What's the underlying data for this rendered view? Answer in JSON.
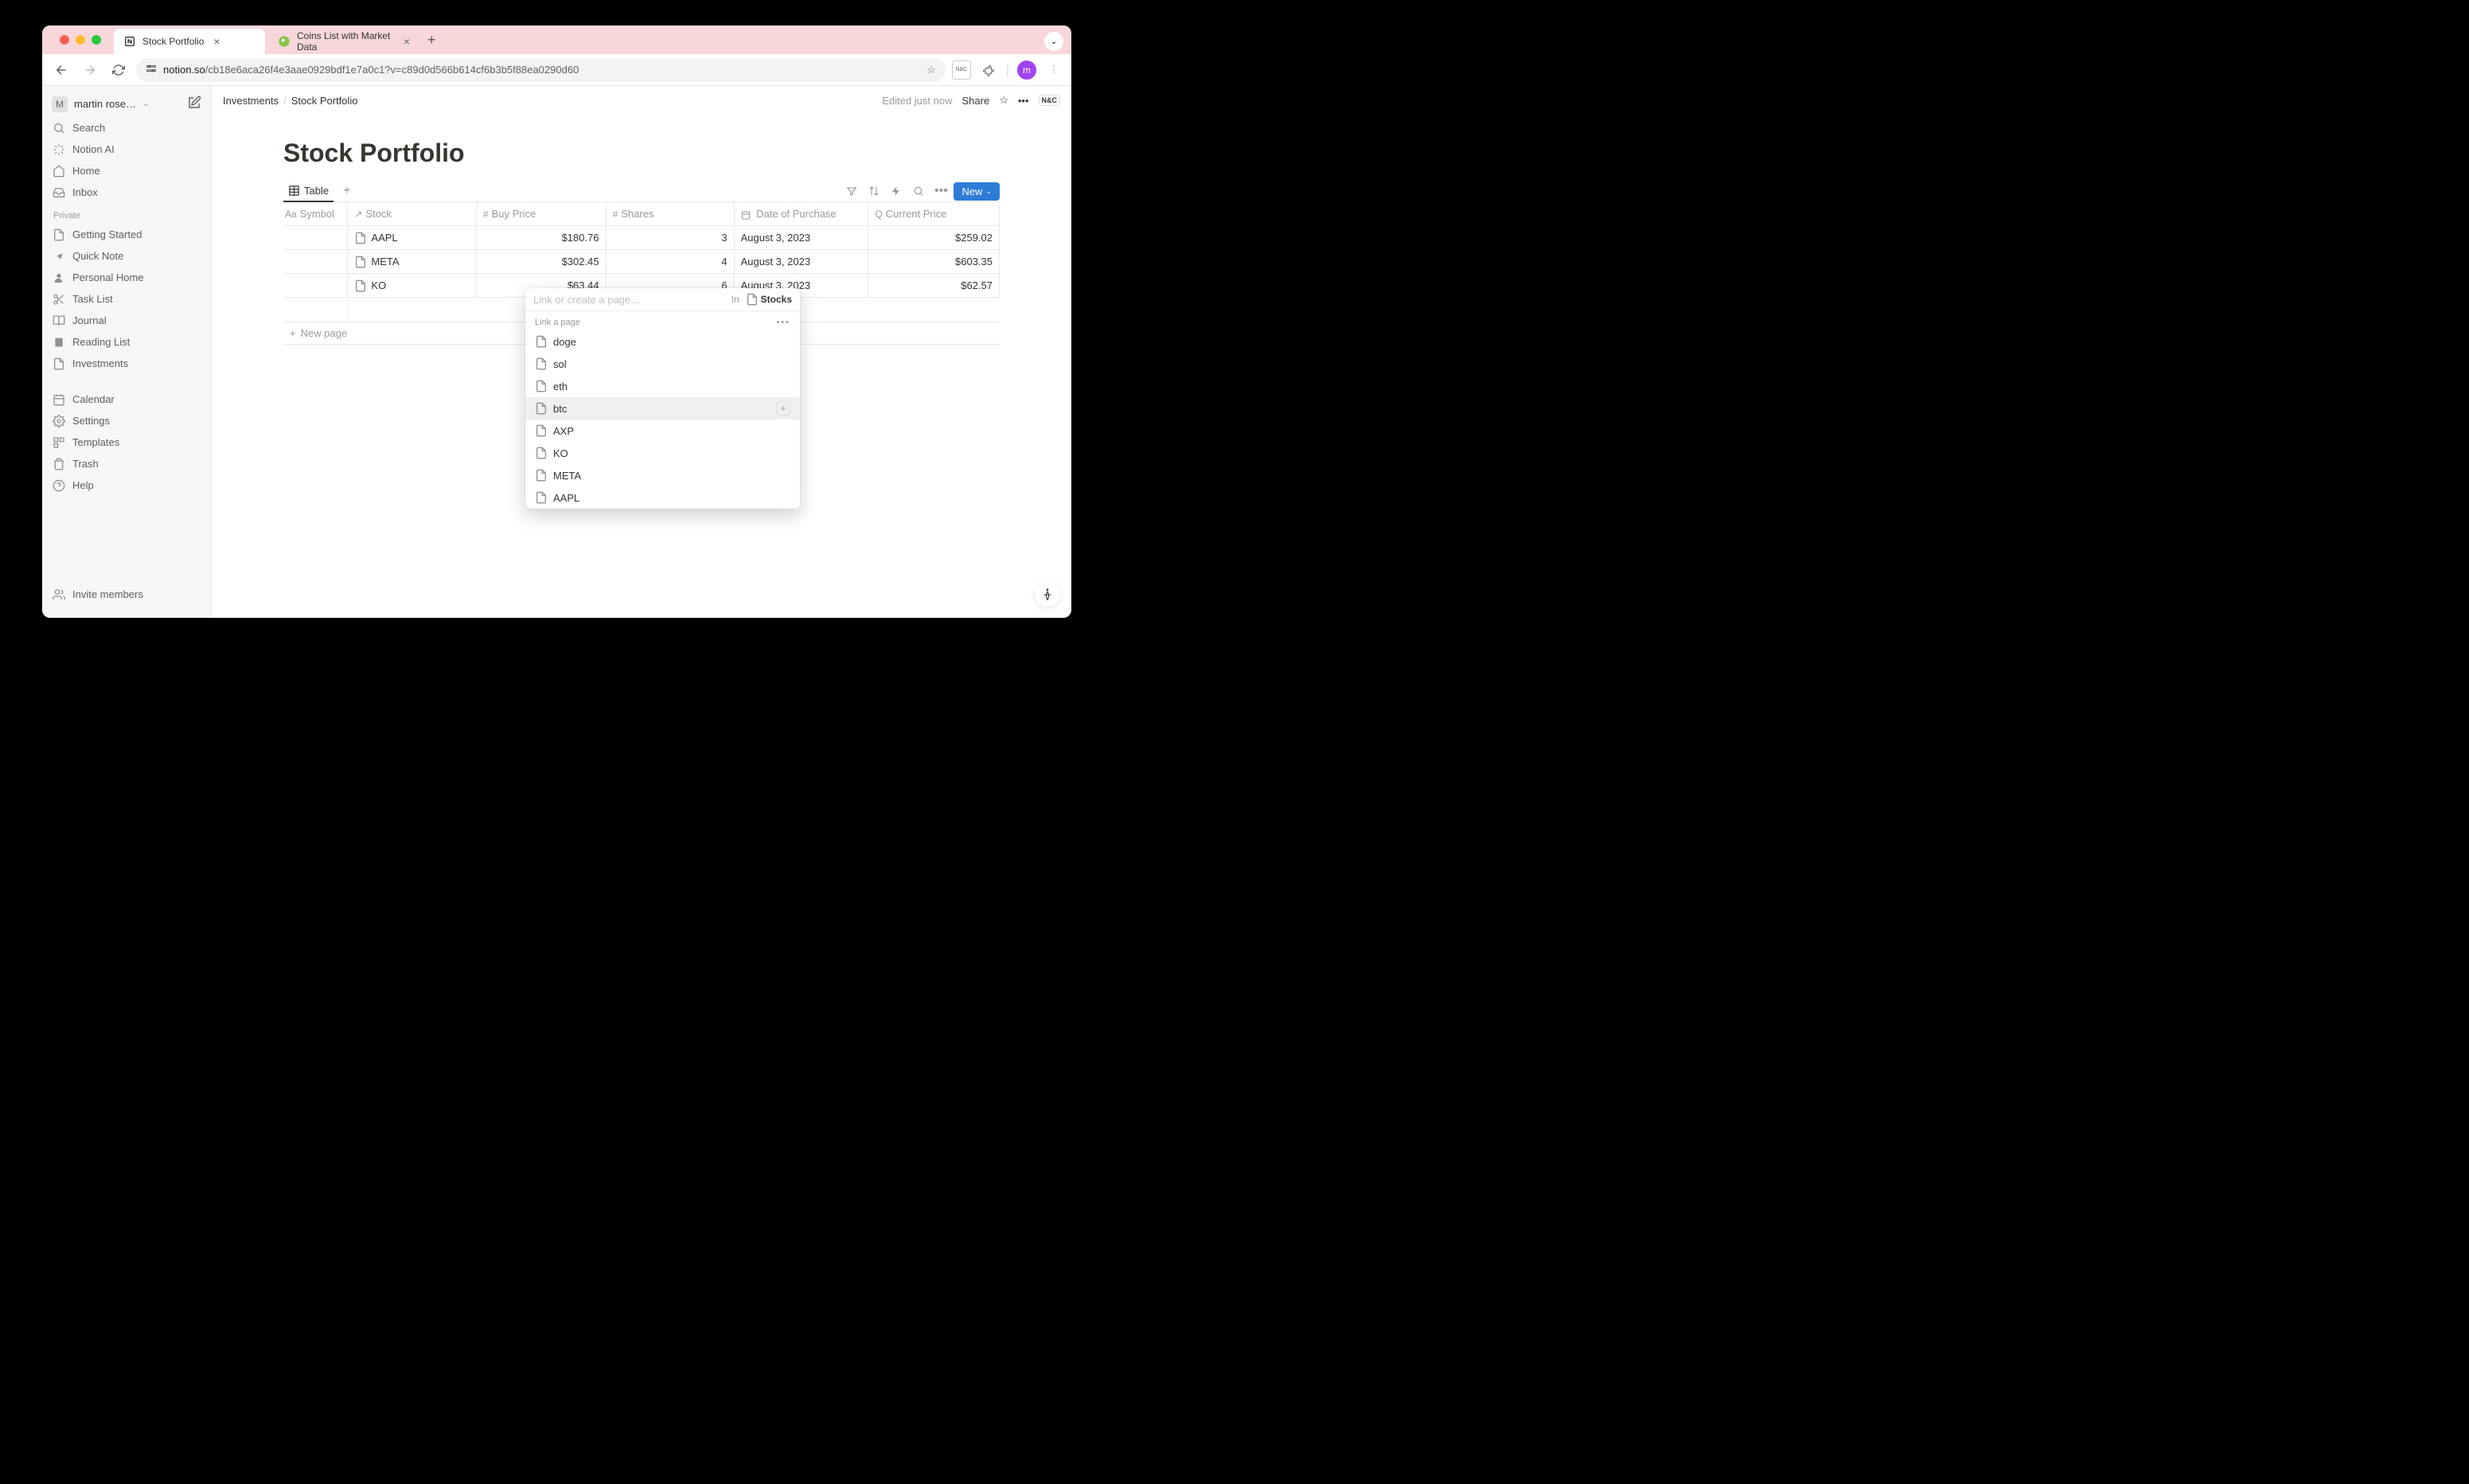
{
  "browser": {
    "tabs": [
      {
        "title": "Stock Portfolio",
        "active": true
      },
      {
        "title": "Coins List with Market Data",
        "active": false
      }
    ],
    "url_host": "notion.so",
    "url_path": "/cb18e6aca26f4e3aae0929bdf1e7a0c1?v=c89d0d566b614cf6b3b5f88ea0290d60",
    "profile_initial": "m"
  },
  "workspace": {
    "name": "martin rose…",
    "initial": "M"
  },
  "sidebar": {
    "top": [
      {
        "label": "Search",
        "icon": "search"
      },
      {
        "label": "Notion AI",
        "icon": "sparkle"
      },
      {
        "label": "Home",
        "icon": "home"
      },
      {
        "label": "Inbox",
        "icon": "inbox"
      }
    ],
    "private_heading": "Private",
    "pages": [
      {
        "label": "Getting Started",
        "icon": "page"
      },
      {
        "label": "Quick Note",
        "icon": "pin"
      },
      {
        "label": "Personal Home",
        "icon": "person"
      },
      {
        "label": "Task List",
        "icon": "scissors"
      },
      {
        "label": "Journal",
        "icon": "book"
      },
      {
        "label": "Reading List",
        "icon": "bookmark"
      },
      {
        "label": "Investments",
        "icon": "page"
      }
    ],
    "tools": [
      {
        "label": "Calendar",
        "icon": "calendar"
      },
      {
        "label": "Settings",
        "icon": "gear"
      },
      {
        "label": "Templates",
        "icon": "template"
      },
      {
        "label": "Trash",
        "icon": "trash"
      },
      {
        "label": "Help",
        "icon": "help"
      }
    ],
    "invite": "Invite members"
  },
  "topbar": {
    "crumb_parent": "Investments",
    "crumb_current": "Stock Portfolio",
    "edited": "Edited just now",
    "share": "Share",
    "badge": "N&C"
  },
  "page": {
    "title": "Stock Portfolio",
    "view_label": "Table",
    "new_button": "New",
    "new_page": "New page"
  },
  "table": {
    "columns": [
      {
        "label": "Symbol",
        "icon": "Aa"
      },
      {
        "label": "Stock",
        "icon": "↗"
      },
      {
        "label": "Buy Price",
        "icon": "#"
      },
      {
        "label": "Shares",
        "icon": "#"
      },
      {
        "label": "Date of Purchase",
        "icon": "📅"
      },
      {
        "label": "Current Price",
        "icon": "Q"
      }
    ],
    "rows": [
      {
        "symbol": "",
        "stock": "AAPL",
        "buy_price": "$180.76",
        "shares": "3",
        "date": "August 3, 2023",
        "current": "$259.02"
      },
      {
        "symbol": "",
        "stock": "META",
        "buy_price": "$302.45",
        "shares": "4",
        "date": "August 3, 2023",
        "current": "$603.35"
      },
      {
        "symbol": "",
        "stock": "KO",
        "buy_price": "$63.44",
        "shares": "6",
        "date": "August 3, 2023",
        "current": "$62.57"
      }
    ]
  },
  "popover": {
    "placeholder": "Link or create a page…",
    "in_label": "In",
    "in_target": "Stocks",
    "section_label": "Link a page",
    "options": [
      {
        "label": "doge"
      },
      {
        "label": "sol"
      },
      {
        "label": "eth"
      },
      {
        "label": "btc",
        "hover": true
      },
      {
        "label": "AXP"
      },
      {
        "label": "KO"
      },
      {
        "label": "META"
      },
      {
        "label": "AAPL"
      }
    ]
  }
}
